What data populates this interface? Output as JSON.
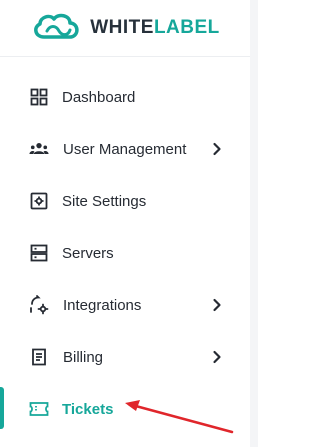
{
  "brand": {
    "prefix": "WHITE",
    "suffix": "LABEL"
  },
  "menu": {
    "items": [
      {
        "label": "Dashboard",
        "icon": "grid-icon",
        "has_submenu": false
      },
      {
        "label": "User Management",
        "icon": "users-icon",
        "has_submenu": true
      },
      {
        "label": "Site Settings",
        "icon": "settings-icon",
        "has_submenu": false
      },
      {
        "label": "Servers",
        "icon": "server-icon",
        "has_submenu": false
      },
      {
        "label": "Integrations",
        "icon": "integrations-icon",
        "has_submenu": true
      },
      {
        "label": "Billing",
        "icon": "billing-icon",
        "has_submenu": true
      },
      {
        "label": "Tickets",
        "icon": "ticket-icon",
        "has_submenu": false,
        "active": true
      }
    ]
  },
  "colors": {
    "accent": "#16a79a",
    "text": "#262b33",
    "annotation_arrow": "#e0262b"
  }
}
